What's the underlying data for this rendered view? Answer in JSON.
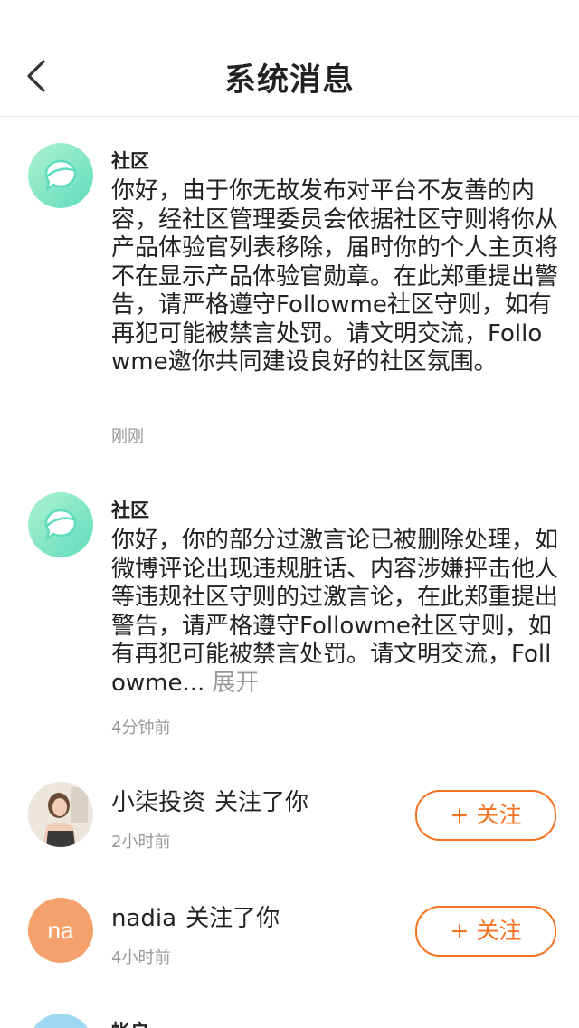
{
  "header": {
    "title": "系统消息"
  },
  "messages": [
    {
      "sender": "社区",
      "text": "你好，由于你无故发布对平台不友善的内容，经社区管理委员会依据社区守则将你从产品体验官列表移除，届时你的个人主页将不在显示产品体验官勋章。在此郑重提出警告，请严格遵守Followme社区守则，如有再犯可能被禁言处罚。请文明交流，Followme邀你共同建设良好的社区氛围。",
      "time": "刚刚"
    },
    {
      "sender": "社区",
      "text": "你好，你的部分过激言论已被删除处理，如微博评论出现违规脏话、内容涉嫌抨击他人等违规社区守则的过激言论，在此郑重提出警告，请严格遵守Followme社区守则，如有再犯可能被禁言处罚。请文明交流，Followme...",
      "expand": "展开",
      "time": "4分钟前"
    }
  ],
  "follows": [
    {
      "name": "小柒投资",
      "action": "关注了你",
      "time": "2小时前",
      "button": "关注",
      "button_icon": "plus-icon"
    },
    {
      "name": "nadia",
      "avatar_text": "na",
      "action": "关注了你",
      "time": "4小时前",
      "button": "关注",
      "button_icon": "plus-icon"
    }
  ],
  "partial": {
    "sender": "帐户"
  },
  "colors": {
    "accent": "#f5731f",
    "avatar_green": "#5fdcbc",
    "avatar_orange": "#f5a16b",
    "muted": "#999999"
  }
}
